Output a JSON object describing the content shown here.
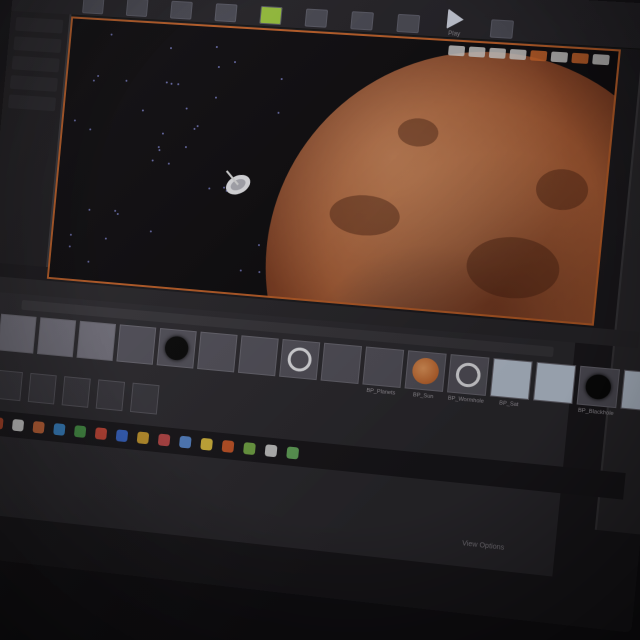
{
  "toolbar": {
    "buttons": [
      {
        "label": "",
        "icon": "generic-tool-icon"
      },
      {
        "label": "",
        "icon": "generic-tool-icon"
      },
      {
        "label": "",
        "icon": "generic-tool-icon"
      },
      {
        "label": "",
        "icon": "generic-tool-icon"
      },
      {
        "label": "",
        "icon": "marketplace-icon",
        "accent": "#9ac43c"
      },
      {
        "label": "",
        "icon": "generic-tool-icon"
      },
      {
        "label": "",
        "icon": "generic-tool-icon"
      },
      {
        "label": "",
        "icon": "build-icon"
      },
      {
        "label": "Play",
        "icon": "play-icon"
      },
      {
        "label": "",
        "icon": "launch-icon"
      }
    ]
  },
  "viewport": {
    "toolbar_chips": [
      "",
      "",
      "",
      "",
      "",
      "",
      "",
      ""
    ],
    "accent": "#c06028"
  },
  "content_browser": {
    "tabs": [
      "",
      ""
    ],
    "assets": [
      {
        "label": "",
        "kind": "folder"
      },
      {
        "label": "",
        "kind": "folder"
      },
      {
        "label": "",
        "kind": "folder"
      },
      {
        "label": "",
        "kind": "material"
      },
      {
        "label": "",
        "kind": "black-sphere"
      },
      {
        "label": "",
        "kind": "material"
      },
      {
        "label": "",
        "kind": "material"
      },
      {
        "label": "",
        "kind": "ring"
      },
      {
        "label": "",
        "kind": "blueprint"
      },
      {
        "label": "BP_Planets",
        "kind": "material"
      },
      {
        "label": "BP_Sun",
        "kind": "mars"
      },
      {
        "label": "BP_Wormhole",
        "kind": "ring"
      },
      {
        "label": "BP_Sat",
        "kind": "light"
      },
      {
        "label": "",
        "kind": "light"
      },
      {
        "label": "BP_Blackhole",
        "kind": "black-sphere"
      },
      {
        "label": "",
        "kind": "light"
      }
    ],
    "footer": "View Options"
  }
}
